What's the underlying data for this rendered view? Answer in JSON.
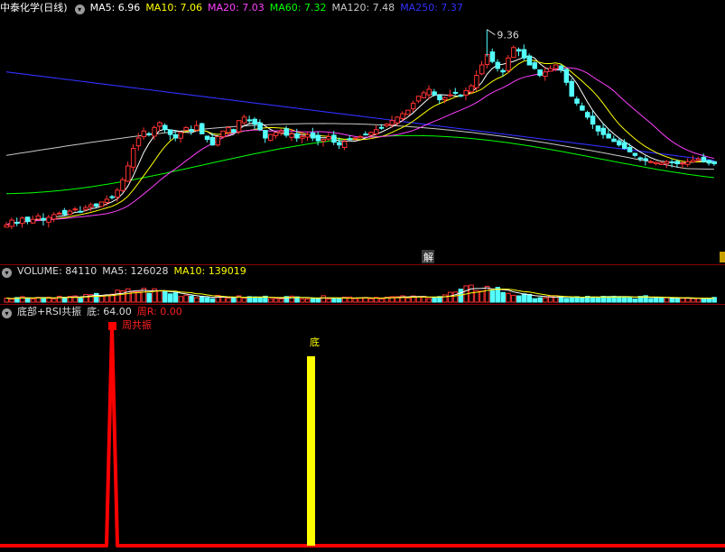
{
  "colors": {
    "up": "#ff3232",
    "down": "#54ffff",
    "ma5": "#ffffff",
    "ma10": "#ffff00",
    "ma20": "#ff40ff",
    "ma60": "#00ff00",
    "ma120": "#c8c8c8",
    "ma250": "#3030ff",
    "separator": "#8b0000"
  },
  "main_panel": {
    "stock_name": "中泰化学(日线)",
    "legend": [
      {
        "label": "MA5: 6.96",
        "color": "#ffffff"
      },
      {
        "label": "MA10: 7.06",
        "color": "#ffff00"
      },
      {
        "label": "MA20: 7.03",
        "color": "#ff40ff"
      },
      {
        "label": "MA60: 7.32",
        "color": "#00ff00"
      },
      {
        "label": "MA120: 7.48",
        "color": "#c8c8c8"
      },
      {
        "label": "MA250: 7.37",
        "color": "#3030ff"
      }
    ],
    "high_label": "9.36",
    "event_label": "解"
  },
  "volume_panel": {
    "legend": [
      {
        "label": "VOLUME: 84110",
        "color": "#dddddd"
      },
      {
        "label": "MA5: 126028",
        "color": "#dddddd"
      },
      {
        "label": "MA10: 139019",
        "color": "#ffff00"
      }
    ]
  },
  "indicator_panel": {
    "legend": [
      {
        "label": "底部+RSI共振",
        "color": "#dddddd"
      },
      {
        "label": "底: 64.00",
        "color": "#dddddd"
      },
      {
        "label": "周R: 0.00",
        "color": "#ff2020"
      }
    ],
    "signal_label": "周共振",
    "bottom_label": "底"
  },
  "chart_data": {
    "type": "candlestick",
    "price_range": [
      6.05,
      9.55
    ],
    "closes": [
      6.55,
      6.62,
      6.58,
      6.65,
      6.6,
      6.63,
      6.68,
      6.62,
      6.66,
      6.7,
      6.72,
      6.7,
      6.75,
      6.78,
      6.74,
      6.8,
      6.84,
      6.82,
      6.88,
      6.92,
      6.95,
      7.05,
      7.2,
      7.4,
      7.65,
      7.8,
      7.9,
      7.85,
      7.95,
      8.02,
      7.92,
      7.85,
      7.8,
      7.88,
      7.95,
      7.9,
      7.98,
      7.86,
      7.78,
      7.7,
      7.82,
      7.9,
      7.95,
      7.88,
      8.05,
      8.1,
      8.05,
      8.0,
      7.92,
      7.8,
      7.85,
      7.88,
      7.9,
      7.84,
      7.86,
      7.8,
      7.82,
      7.85,
      7.8,
      7.76,
      7.78,
      7.82,
      7.74,
      7.7,
      7.75,
      7.78,
      7.8,
      7.82,
      7.85,
      7.88,
      7.92,
      7.95,
      8.0,
      8.05,
      8.1,
      8.15,
      8.2,
      8.3,
      8.4,
      8.45,
      8.5,
      8.42,
      8.35,
      8.38,
      8.42,
      8.45,
      8.4,
      8.48,
      8.55,
      8.7,
      8.85,
      9.0,
      8.9,
      8.8,
      8.75,
      8.95,
      9.1,
      9.05,
      8.95,
      8.85,
      8.8,
      8.7,
      8.75,
      8.8,
      8.85,
      8.78,
      8.6,
      8.4,
      8.3,
      8.2,
      8.1,
      8.0,
      7.9,
      7.85,
      7.8,
      7.75,
      7.7,
      7.65,
      7.6,
      7.55,
      7.5,
      7.48,
      7.46,
      7.45,
      7.44,
      7.46,
      7.45,
      7.43,
      7.44,
      7.46,
      7.48,
      7.5,
      7.46,
      7.44,
      7.43
    ],
    "high": 9.36,
    "volume_range": [
      0,
      700000
    ]
  }
}
